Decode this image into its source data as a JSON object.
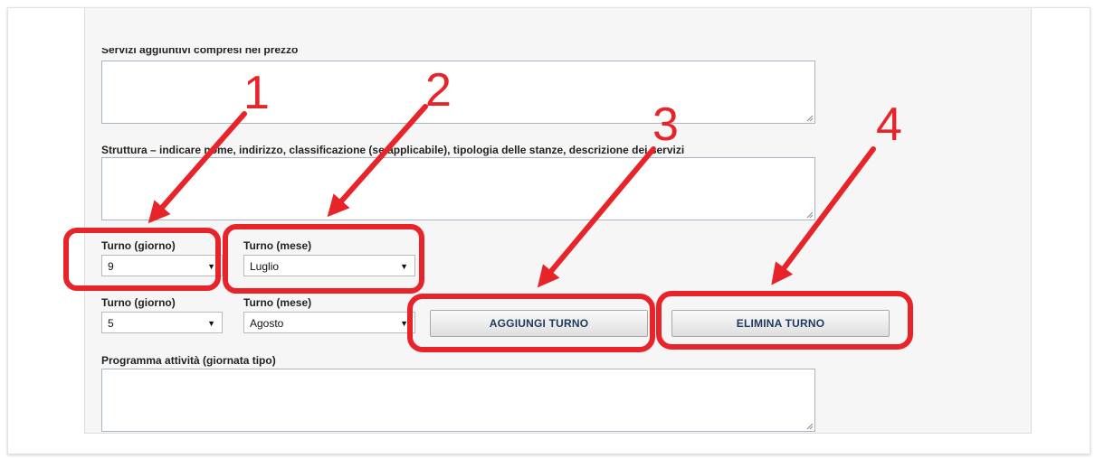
{
  "form": {
    "servizi_label": "Servizi aggiuntivi compresi nel prezzo",
    "struttura_label": "Struttura – indicare nome, indirizzo, classificazione (se applicabile), tipologia delle stanze, descrizione dei servizi",
    "turno_rows": [
      {
        "giorno_label": "Turno (giorno)",
        "giorno_value": "9",
        "mese_label": "Turno (mese)",
        "mese_value": "Luglio"
      },
      {
        "giorno_label": "Turno (giorno)",
        "giorno_value": "5",
        "mese_label": "Turno (mese)",
        "mese_value": "Agosto"
      }
    ],
    "aggiungi_label": "AGGIUNGI TURNO",
    "elimina_label": "ELIMINA TURNO",
    "programma_label": "Programma attività (giornata tipo)"
  },
  "annotations": {
    "numbers": [
      "1",
      "2",
      "3",
      "4"
    ],
    "color": "#e8242b"
  }
}
